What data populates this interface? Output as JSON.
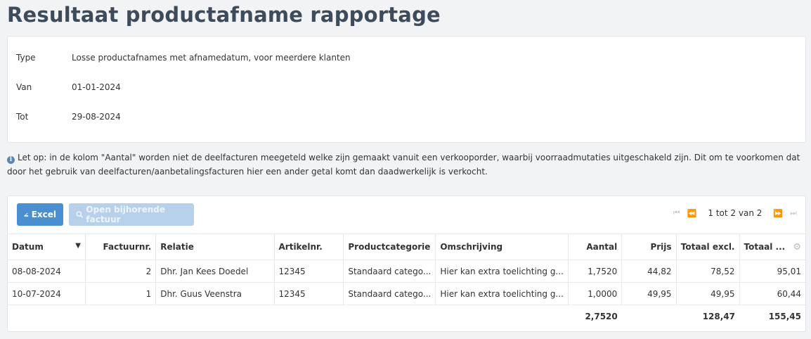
{
  "page": {
    "title": "Resultaat productafname rapportage"
  },
  "info": {
    "rows": [
      {
        "label": "Type",
        "value": "Losse productafnames met afnamedatum, voor meerdere klanten"
      },
      {
        "label": "Van",
        "value": "01-01-2024"
      },
      {
        "label": "Tot",
        "value": "29-08-2024"
      }
    ]
  },
  "notice": {
    "text": "Let op: in de kolom \"Aantal\" worden niet de deelfacturen meegeteld welke zijn gemaakt vanuit een verkooporder, waarbij voorraadmutaties uitgeschakeld zijn. Dit om te voorkomen dat door het gebruik van deelfacturen/aanbetalingsfacturen hier een ander getal komt dan daadwerkelijk is verkocht."
  },
  "toolbar": {
    "excel_label": "Excel",
    "open_label": "Open bijhorende factuur"
  },
  "pager": {
    "text": "1 tot 2 van 2"
  },
  "table": {
    "headers": [
      "Datum",
      "Factuurnr.",
      "Relatie",
      "Artikelnr.",
      "Productcategorie",
      "Omschrijving",
      "Aantal",
      "Prijs",
      "Totaal excl.",
      "Totaal ..."
    ],
    "rows": [
      [
        "08-08-2024",
        "2",
        "Dhr. Jan Kees Doedel",
        "12345",
        "Standaard catego...",
        "Hier kan extra toelichting g...",
        "1,7520",
        "44,82",
        "78,52",
        "95,01"
      ],
      [
        "10-07-2024",
        "1",
        "Dhr. Guus Veenstra",
        "12345",
        "Standaard catego...",
        "Hier kan extra toelichting g...",
        "1,0000",
        "49,95",
        "49,95",
        "60,44"
      ]
    ],
    "totals": {
      "aantal": "2,7520",
      "totaal_excl": "128,47",
      "totaal_incl": "155,45"
    }
  },
  "colors": {
    "primary": "#4a90d0",
    "disabled": "#b7d1ea",
    "title": "#3d4b5a"
  }
}
